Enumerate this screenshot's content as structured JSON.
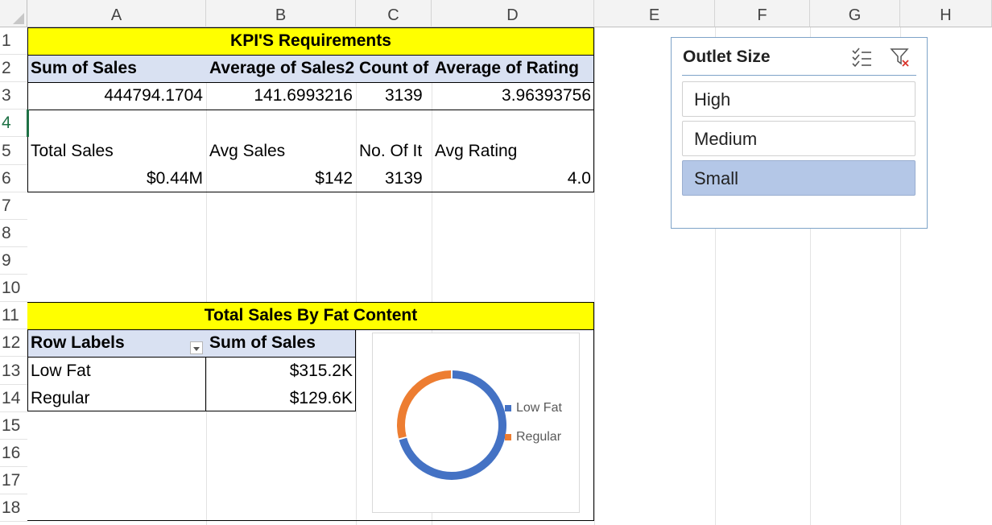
{
  "columns": [
    "A",
    "B",
    "C",
    "D",
    "E",
    "F",
    "G",
    "H"
  ],
  "rows": [
    "1",
    "2",
    "3",
    "4",
    "5",
    "6",
    "7",
    "8",
    "9",
    "10",
    "11",
    "12",
    "13",
    "14",
    "15",
    "16",
    "17",
    "18"
  ],
  "kpi": {
    "title": "KPI'S Requirements",
    "headers": [
      "Sum of Sales",
      "Average of Sales2",
      "Count of",
      "Average of Rating"
    ],
    "values": [
      "444794.1704",
      "141.6993216",
      "3139",
      "3.96393756"
    ],
    "labels": [
      "Total Sales",
      "Avg Sales",
      "No. Of It",
      "Avg Rating"
    ],
    "formatted": [
      "$0.44M",
      "$142",
      "3139",
      "4.0"
    ]
  },
  "fat": {
    "title": "Total Sales By Fat Content",
    "header_labels": "Row Labels",
    "header_sum": "Sum of Sales",
    "rows": [
      {
        "label": "Low Fat",
        "value": "$315.2K"
      },
      {
        "label": "Regular",
        "value": "$129.6K"
      }
    ]
  },
  "slicer": {
    "title": "Outlet Size",
    "items": [
      "High",
      "Medium",
      "Small"
    ],
    "selected": "Small"
  },
  "chart_data": {
    "type": "pie",
    "categories": [
      "Low Fat",
      "Regular"
    ],
    "values": [
      315.2,
      129.6
    ],
    "colors": [
      "#4472c4",
      "#ed7d31"
    ],
    "legend": "right"
  }
}
